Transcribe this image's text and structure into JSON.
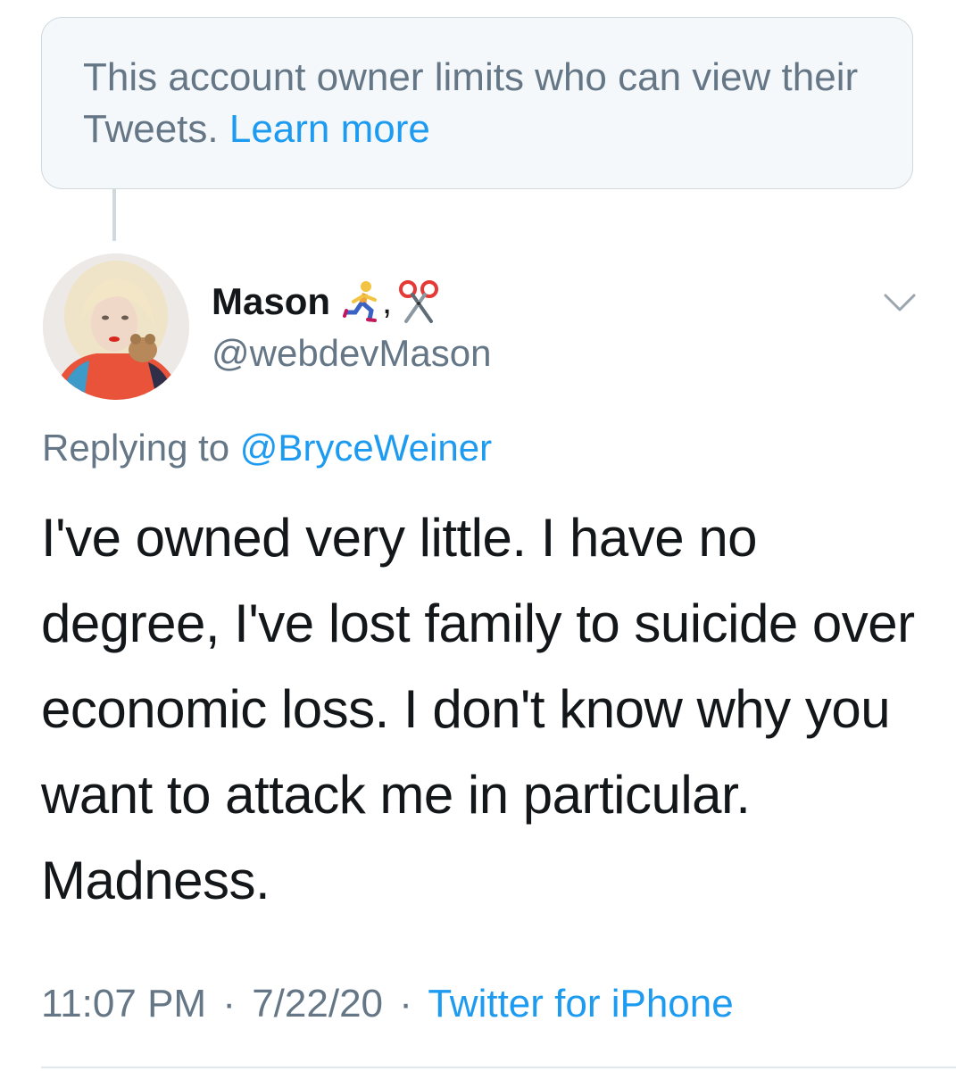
{
  "notice": {
    "text": "This account owner limits who can view their Tweets.",
    "link": "Learn more"
  },
  "author": {
    "display_name": "Mason",
    "emoji_icons": [
      "man-running-icon",
      "scissors-icon"
    ],
    "emoji_separator": ",",
    "handle": "@webdevMason"
  },
  "reply": {
    "prefix": "Replying to",
    "mention": "@BryceWeiner"
  },
  "tweet": {
    "text": "I've owned very little. I have no degree, I've lost family to suicide over economic loss. I don't know why you want to attack me in particular. Madness."
  },
  "meta": {
    "time": "11:07 PM",
    "separator": "·",
    "date": "7/22/20",
    "source": "Twitter for iPhone"
  },
  "colors": {
    "link": "#1d9bf0",
    "muted": "#657786",
    "text": "#14171a",
    "notice_bg": "#f5f8fa",
    "border": "#cfd9de"
  }
}
